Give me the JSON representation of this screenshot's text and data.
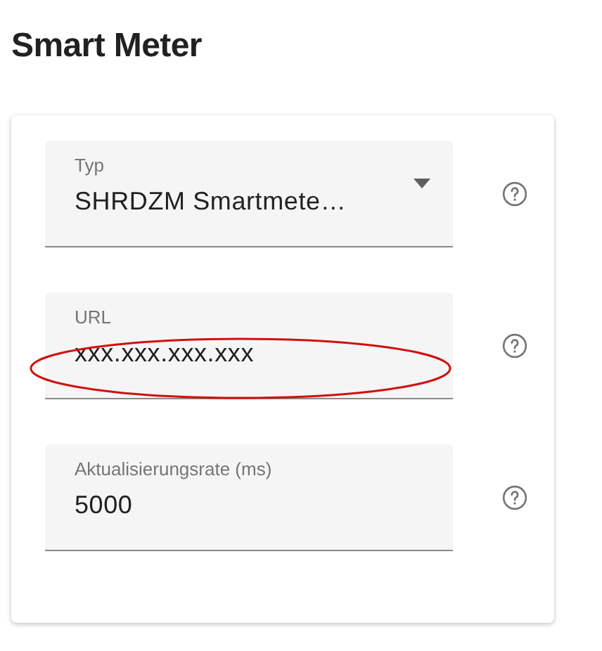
{
  "title": "Smart Meter",
  "fields": [
    {
      "kind": "select",
      "label": "Typ",
      "value": "SHRDZM Smartmete…",
      "highlighted": false
    },
    {
      "kind": "text",
      "label": "URL",
      "value": "xxx.xxx.xxx.xxx",
      "highlighted": true
    },
    {
      "kind": "text",
      "label": "Aktualisierungsrate (ms)",
      "value": "5000",
      "highlighted": false
    }
  ]
}
